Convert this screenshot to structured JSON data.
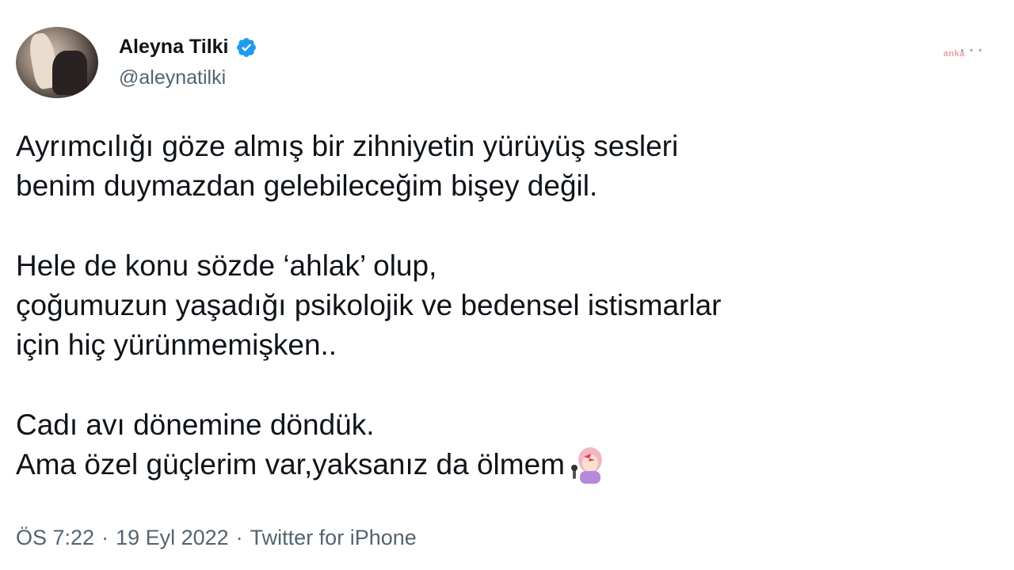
{
  "author": {
    "display_name": "Aleyna Tilki",
    "handle": "@aleynatilki",
    "verified_icon": "verified-badge-icon",
    "avatar_icon": "profile-photo"
  },
  "watermark": "anka",
  "more_icon": "more-options-icon",
  "tweet": {
    "paragraphs": [
      "Ayrımcılığı göze almış bir zihniyetin  yürüyüş sesleri\nbenim duymazdan gelebileceğim bişey değil.",
      "Hele de konu sözde ‘ahlak’ olup,\nçoğumuzun yaşadığı psikolojik ve bedensel istismarlar\niçin hiç yürünmemişken..",
      "Cadı avı dönemine döndük.\nAma özel güçlerim var,yaksanız da ölmem"
    ],
    "emoji_name": "woman-singer-emoji"
  },
  "meta": {
    "time": "ÖS 7:22",
    "date": "19 Eyl 2022",
    "source": "Twitter for iPhone",
    "separator": "·"
  },
  "colors": {
    "text_primary": "#0f1419",
    "text_secondary": "#536471",
    "verified_blue": "#1d9bf0"
  }
}
